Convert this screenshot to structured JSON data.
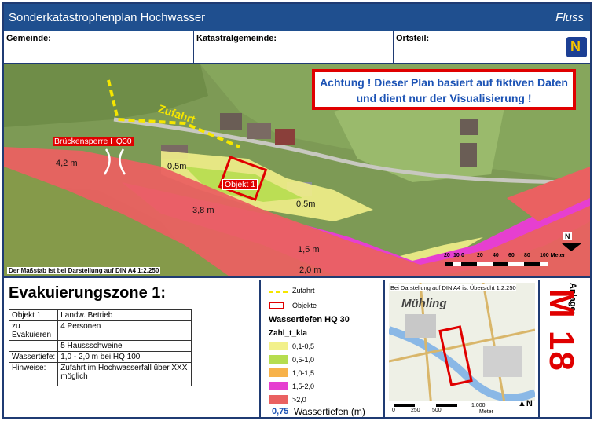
{
  "header": {
    "title": "Sonderkatastrophenplan Hochwasser",
    "right_label": "Fluss"
  },
  "fields": {
    "gemeinde": "Gemeinde:",
    "katastral": "Katastralgemeinde:",
    "ortsteil": "Ortsteil:"
  },
  "logo": {
    "letter": "N"
  },
  "map": {
    "warning_line1": "Achtung ! Dieser Plan basiert auf fiktiven Daten",
    "warning_line2": "und dient nur der Visualisierung !",
    "zufahrt": "Zufahrt",
    "brueckensperre": "Brückensperre HQ30",
    "objekt": "Objekt 1",
    "depths": [
      "4,2 m",
      "0,5m",
      "3,8 m",
      "0,5m",
      "1,5 m",
      "2,0 m"
    ],
    "scale_note": "Der Maßstab ist bei Darstellung auf DIN A4 1:2.250",
    "scale_ticks": [
      "20",
      "10",
      "0",
      "20",
      "40",
      "60",
      "80",
      "100 Meter"
    ]
  },
  "evac": {
    "title": "Evakuierungszone 1:",
    "rows": [
      [
        "Objekt 1",
        "Landw. Betrieb"
      ],
      [
        "zu Evakuieren",
        "4 Personen"
      ],
      [
        "",
        "5 Haussschweine"
      ],
      [
        "Wassertiefe:",
        "1,0 - 2,0 m bei HQ 100"
      ],
      [
        "Hinweise:",
        "Zufahrt im Hochwasserfall über XXX möglich"
      ]
    ]
  },
  "legend": {
    "zufahrt": "Zufahrt",
    "objekte": "Objekte",
    "title": "Wassertiefen HQ 30",
    "field": "Zahl_t_kla",
    "classes": [
      {
        "label": "0,1-0,5",
        "color": "#f2f08a"
      },
      {
        "label": "0,5-1,0",
        "color": "#b6dd4f"
      },
      {
        "label": "1,0-1,5",
        "color": "#f7b24a"
      },
      {
        "label": "1,5-2,0",
        "color": "#e63fd0"
      },
      {
        "label": ">2,0",
        "color": "#ea6161"
      }
    ],
    "sample_value": "0,75",
    "sample_label": "Wassertiefen (m)"
  },
  "overview": {
    "note": "Bei Darstellung auf DIN A4 ist Übersicht 1:2.250",
    "place": "Mühling",
    "scale_ticks": [
      "0",
      "250",
      "500",
      "1.000"
    ],
    "scale_unit": "Meter"
  },
  "anlage": {
    "label": "Anlage:",
    "value": "M 18"
  }
}
